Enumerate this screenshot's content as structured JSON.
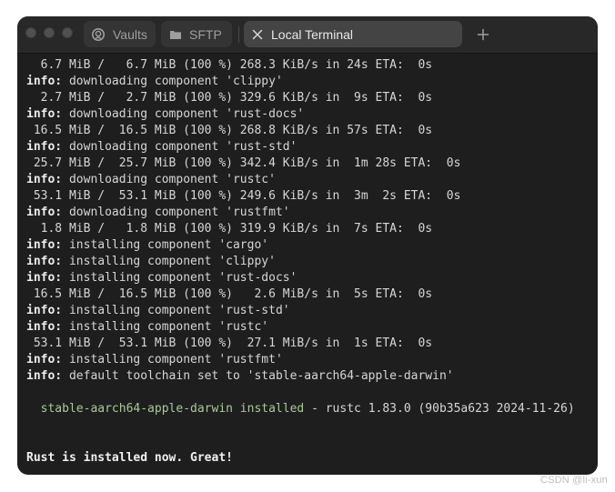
{
  "tabs": [
    {
      "label": "Vaults",
      "icon": "vault-icon",
      "active": false
    },
    {
      "label": "SFTP",
      "icon": "folder-icon",
      "active": false
    },
    {
      "label": "Local Terminal",
      "icon": "close-icon",
      "active": true
    }
  ],
  "new_tab_icon": "plus-icon",
  "colors": {
    "terminal_bg": "#1e1e1e",
    "titlebar_bg": "#282828",
    "active_tab_bg": "#444444",
    "installed_green": "#a9c99a"
  },
  "terminal": {
    "lines": [
      {
        "prefix": "",
        "text": "  6.7 MiB /   6.7 MiB (100 %) 268.3 KiB/s in 24s ETA:  0s"
      },
      {
        "prefix": "info:",
        "text": " downloading component 'clippy'"
      },
      {
        "prefix": "",
        "text": "  2.7 MiB /   2.7 MiB (100 %) 329.6 KiB/s in  9s ETA:  0s"
      },
      {
        "prefix": "info:",
        "text": " downloading component 'rust-docs'"
      },
      {
        "prefix": "",
        "text": " 16.5 MiB /  16.5 MiB (100 %) 268.8 KiB/s in 57s ETA:  0s"
      },
      {
        "prefix": "info:",
        "text": " downloading component 'rust-std'"
      },
      {
        "prefix": "",
        "text": " 25.7 MiB /  25.7 MiB (100 %) 342.4 KiB/s in  1m 28s ETA:  0s"
      },
      {
        "prefix": "info:",
        "text": " downloading component 'rustc'"
      },
      {
        "prefix": "",
        "text": " 53.1 MiB /  53.1 MiB (100 %) 249.6 KiB/s in  3m  2s ETA:  0s"
      },
      {
        "prefix": "info:",
        "text": " downloading component 'rustfmt'"
      },
      {
        "prefix": "",
        "text": "  1.8 MiB /   1.8 MiB (100 %) 319.9 KiB/s in  7s ETA:  0s"
      },
      {
        "prefix": "info:",
        "text": " installing component 'cargo'"
      },
      {
        "prefix": "info:",
        "text": " installing component 'clippy'"
      },
      {
        "prefix": "info:",
        "text": " installing component 'rust-docs'"
      },
      {
        "prefix": "",
        "text": " 16.5 MiB /  16.5 MiB (100 %)   2.6 MiB/s in  5s ETA:  0s"
      },
      {
        "prefix": "info:",
        "text": " installing component 'rust-std'"
      },
      {
        "prefix": "info:",
        "text": " installing component 'rustc'"
      },
      {
        "prefix": "",
        "text": " 53.1 MiB /  53.1 MiB (100 %)  27.1 MiB/s in  1s ETA:  0s"
      },
      {
        "prefix": "info:",
        "text": " installing component 'rustfmt'"
      },
      {
        "prefix": "info:",
        "text": " default toolchain set to 'stable-aarch64-apple-darwin'"
      }
    ],
    "installed": {
      "toolchain": "stable-aarch64-apple-darwin installed",
      "rest": " - rustc 1.83.0 (90b35a623 2024-11-26)"
    },
    "final_message": "Rust is installed now. Great!"
  },
  "watermark": "CSDN @li-xun"
}
